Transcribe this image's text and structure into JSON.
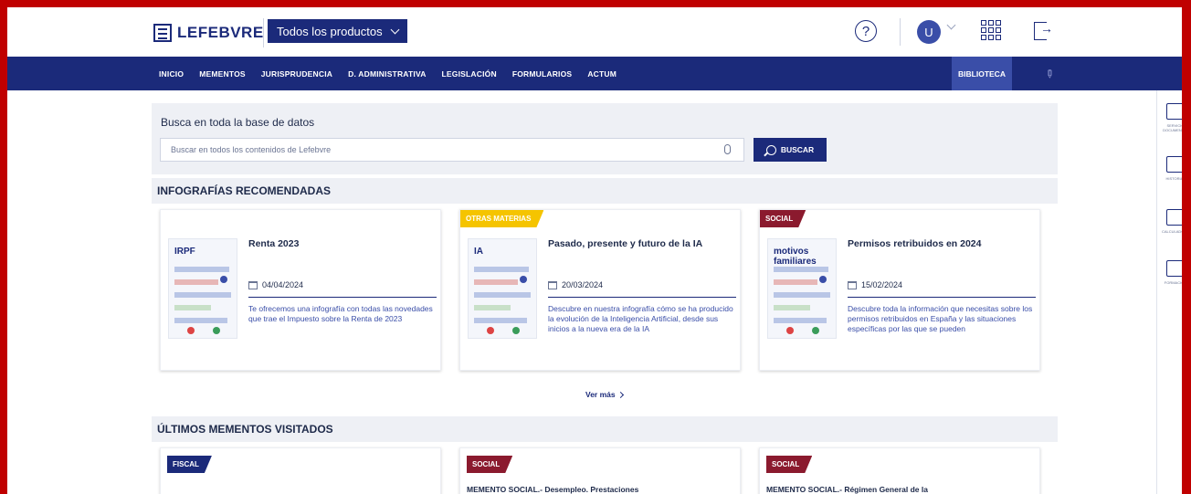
{
  "header": {
    "logo_text": "LEFEBVRE",
    "products_label": "Todos los productos",
    "help_glyph": "?",
    "avatar_initial": "U"
  },
  "nav": {
    "items": [
      "INICIO",
      "MEMENTOS",
      "JURISPRUDENCIA",
      "D. ADMINISTRATIVA",
      "LEGISLACIÓN",
      "FORMULARIOS",
      "ACTUM"
    ],
    "biblioteca": "BIBLIOTECA"
  },
  "sidebar": {
    "items": [
      {
        "label": "SERVICIO DOCUMENTAL",
        "icon": "briefcase-icon"
      },
      {
        "label": "HISTORIAL",
        "icon": "history-icon"
      },
      {
        "label": "CALCULADORA",
        "icon": "calculator-icon"
      },
      {
        "label": "FORMACIÓN",
        "icon": "graduation-icon"
      }
    ]
  },
  "search": {
    "title": "Busca en toda la base de datos",
    "placeholder": "Buscar en todos los contenidos de Lefebvre",
    "button_label": "BUSCAR"
  },
  "infografias": {
    "heading": "INFOGRAFÍAS RECOMENDADAS",
    "cards": [
      {
        "tag": "",
        "tag_color": "",
        "title": "Renta 2023",
        "date": "04/04/2024",
        "desc": "Te ofrecemos una infografía con todas las novedades que trae el Impuesto sobre la Renta de 2023",
        "thumb_title": "IRPF"
      },
      {
        "tag": "OTRAS MATERIAS",
        "tag_color": "#f5c400",
        "title": "Pasado, presente y futuro de la IA",
        "date": "20/03/2024",
        "desc": "Descubre en nuestra infografía cómo se ha producido la evolución de la Inteligencia Artificial, desde sus inicios a la nueva era de la IA",
        "thumb_title": "IA"
      },
      {
        "tag": "SOCIAL",
        "tag_color": "#8b1a2e",
        "title": "Permisos retribuidos en 2024",
        "date": "15/02/2024",
        "desc": "Descubre toda la información que necesitas sobre los permisos retribuidos en España y las situaciones específicas por las que se pueden",
        "thumb_title": "motivos familiares"
      }
    ],
    "ver_mas": "Ver más"
  },
  "mementos": {
    "heading": "ÚLTIMOS MEMENTOS VISITADOS",
    "cards": [
      {
        "tag": "FISCAL",
        "tag_color": "#1b2a7a",
        "title": ""
      },
      {
        "tag": "SOCIAL",
        "tag_color": "#8b1a2e",
        "title": "MEMENTO SOCIAL.- Desempleo. Prestaciones"
      },
      {
        "tag": "SOCIAL",
        "tag_color": "#8b1a2e",
        "title": "MEMENTO SOCIAL.- Régimen General de la"
      }
    ]
  }
}
